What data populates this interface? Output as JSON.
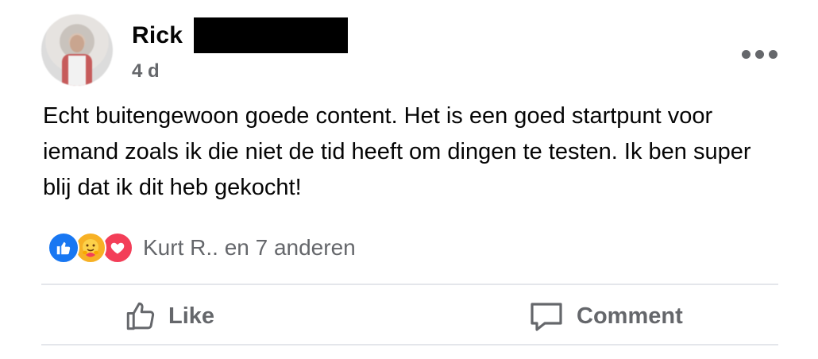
{
  "post": {
    "author_name": "Rick",
    "timestamp": "4 d",
    "body": "Echt buitengewoon goede content. Het is een goed startpunt voor iemand zoals ik die niet de tid heeft om dingen te testen. Ik ben super blij dat ik dit heb gekocht!",
    "reactions": {
      "icons": [
        "like-icon",
        "care-icon",
        "love-icon"
      ],
      "summary": "Kurt R.. en 7 anderen"
    }
  },
  "actions": {
    "like_label": "Like",
    "comment_label": "Comment"
  },
  "colors": {
    "secondary_text": "#65676b",
    "like_blue": "#1877f2",
    "care_yellow": "#f7b125",
    "love_red": "#f33e58",
    "divider": "#e4e6eb"
  }
}
